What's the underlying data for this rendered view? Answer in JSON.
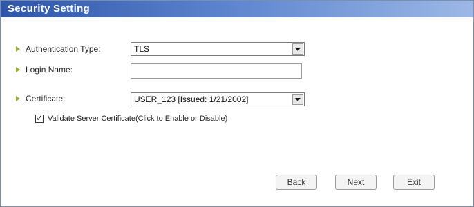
{
  "window": {
    "title": "Security Setting"
  },
  "form": {
    "auth_type": {
      "label": "Authentication Type:",
      "value": "TLS"
    },
    "login_name": {
      "label": "Login Name:",
      "value": ""
    },
    "certificate": {
      "label": "Certificate:",
      "value": "USER_123  [Issued: 1/21/2002]"
    },
    "validate_cert": {
      "label": "Validate Server Certificate(Click to Enable or Disable)",
      "checked": true
    }
  },
  "buttons": {
    "back": "Back",
    "next": "Next",
    "exit": "Exit"
  },
  "colors": {
    "title_bar": "#2f55a8",
    "bullet": "#9ab02c"
  },
  "icons": [
    "bullet-arrow-icon",
    "dropdown-arrow-icon",
    "checkmark-icon"
  ]
}
